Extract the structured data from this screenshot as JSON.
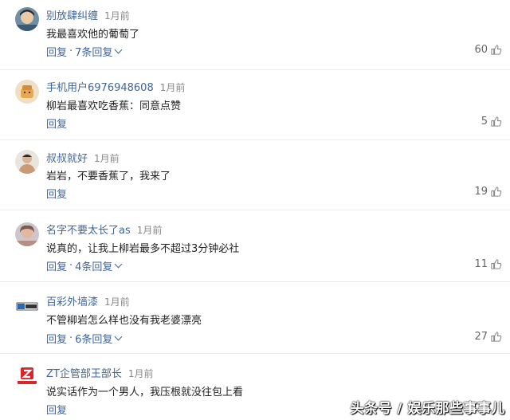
{
  "comments": [
    {
      "user": "别放肆纠缠",
      "time": "1月前",
      "text": "我最喜欢他的葡萄了",
      "reply": "回复",
      "replies": "7条回复",
      "likes": "60"
    },
    {
      "user": "手机用户6976948608",
      "time": "1月前",
      "text": "柳岩最喜欢吃香蕉：同意点赞",
      "reply": "回复",
      "likes": "5"
    },
    {
      "user": "叔叔就好",
      "time": "1月前",
      "text": "岩岩，不要香蕉了，我来了",
      "reply": "回复",
      "likes": "19"
    },
    {
      "user": "名字不要太长了as",
      "time": "1月前",
      "text": "说真的，让我上柳岩最多不超过3分钟必社",
      "reply": "回复",
      "replies": "4条回复",
      "likes": "11"
    },
    {
      "user": "百彩外墙漆",
      "time": "1月前",
      "text": "不管柳岩怎么样也没有我老婆漂亮",
      "reply": "回复",
      "replies": "6条回复",
      "likes": "27"
    },
    {
      "user": "ZT企管部王部长",
      "time": "1月前",
      "text": "说实话作为一个男人，我压根就没往包上看",
      "reply": "回复"
    }
  ],
  "watermark": "头条号 / 娱乐那些事事儿",
  "icons": {
    "like": "thumbs-up-icon",
    "expand": "chevron-down-icon"
  },
  "colors": {
    "username": "#406599",
    "link": "#406599",
    "time": "#888888"
  }
}
